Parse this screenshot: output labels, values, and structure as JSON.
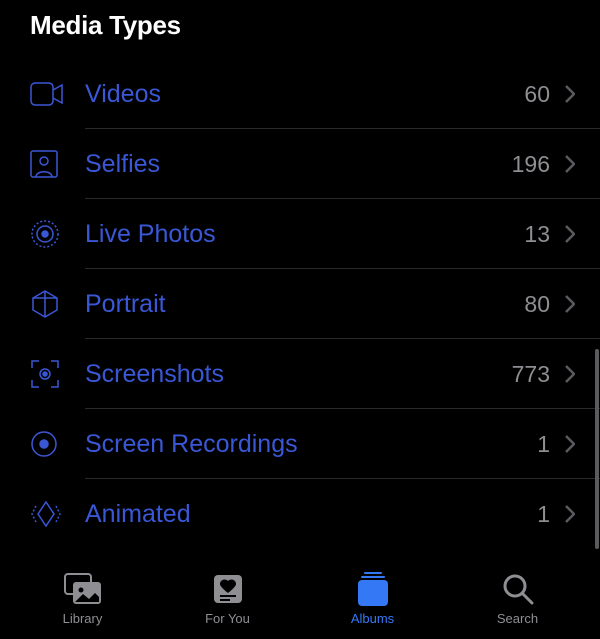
{
  "header": {
    "title": "Media Types"
  },
  "rows": [
    {
      "icon": "video",
      "label": "Videos",
      "count": "60"
    },
    {
      "icon": "selfie",
      "label": "Selfies",
      "count": "196"
    },
    {
      "icon": "livephoto",
      "label": "Live Photos",
      "count": "13"
    },
    {
      "icon": "portrait",
      "label": "Portrait",
      "count": "80"
    },
    {
      "icon": "screenshot",
      "label": "Screenshots",
      "count": "773"
    },
    {
      "icon": "recording",
      "label": "Screen Recordings",
      "count": "1"
    },
    {
      "icon": "animated",
      "label": "Animated",
      "count": "1"
    }
  ],
  "tabs": [
    {
      "id": "library",
      "label": "Library",
      "active": false
    },
    {
      "id": "foryou",
      "label": "For You",
      "active": false
    },
    {
      "id": "albums",
      "label": "Albums",
      "active": true
    },
    {
      "id": "search",
      "label": "Search",
      "active": false
    }
  ]
}
